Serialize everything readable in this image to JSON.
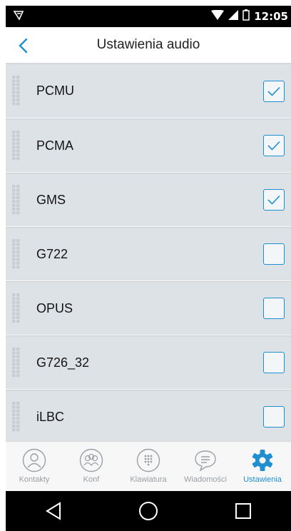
{
  "status_bar": {
    "time": "12:05"
  },
  "app_bar": {
    "title": "Ustawienia audio"
  },
  "codecs": [
    {
      "label": "PCMU",
      "checked": true
    },
    {
      "label": "PCMA",
      "checked": true
    },
    {
      "label": "GMS",
      "checked": true
    },
    {
      "label": "G722",
      "checked": false
    },
    {
      "label": "OPUS",
      "checked": false
    },
    {
      "label": "G726_32",
      "checked": false
    },
    {
      "label": "iLBC",
      "checked": false
    }
  ],
  "bottom_nav": {
    "contacts": "Kontakty",
    "conf": "Konf",
    "keypad": "Klawiatura",
    "messages": "Wiadomości",
    "settings": "Ustawienia",
    "active": "settings"
  },
  "colors": {
    "accent": "#1f8fcf",
    "list_bg": "#dce2e6"
  }
}
